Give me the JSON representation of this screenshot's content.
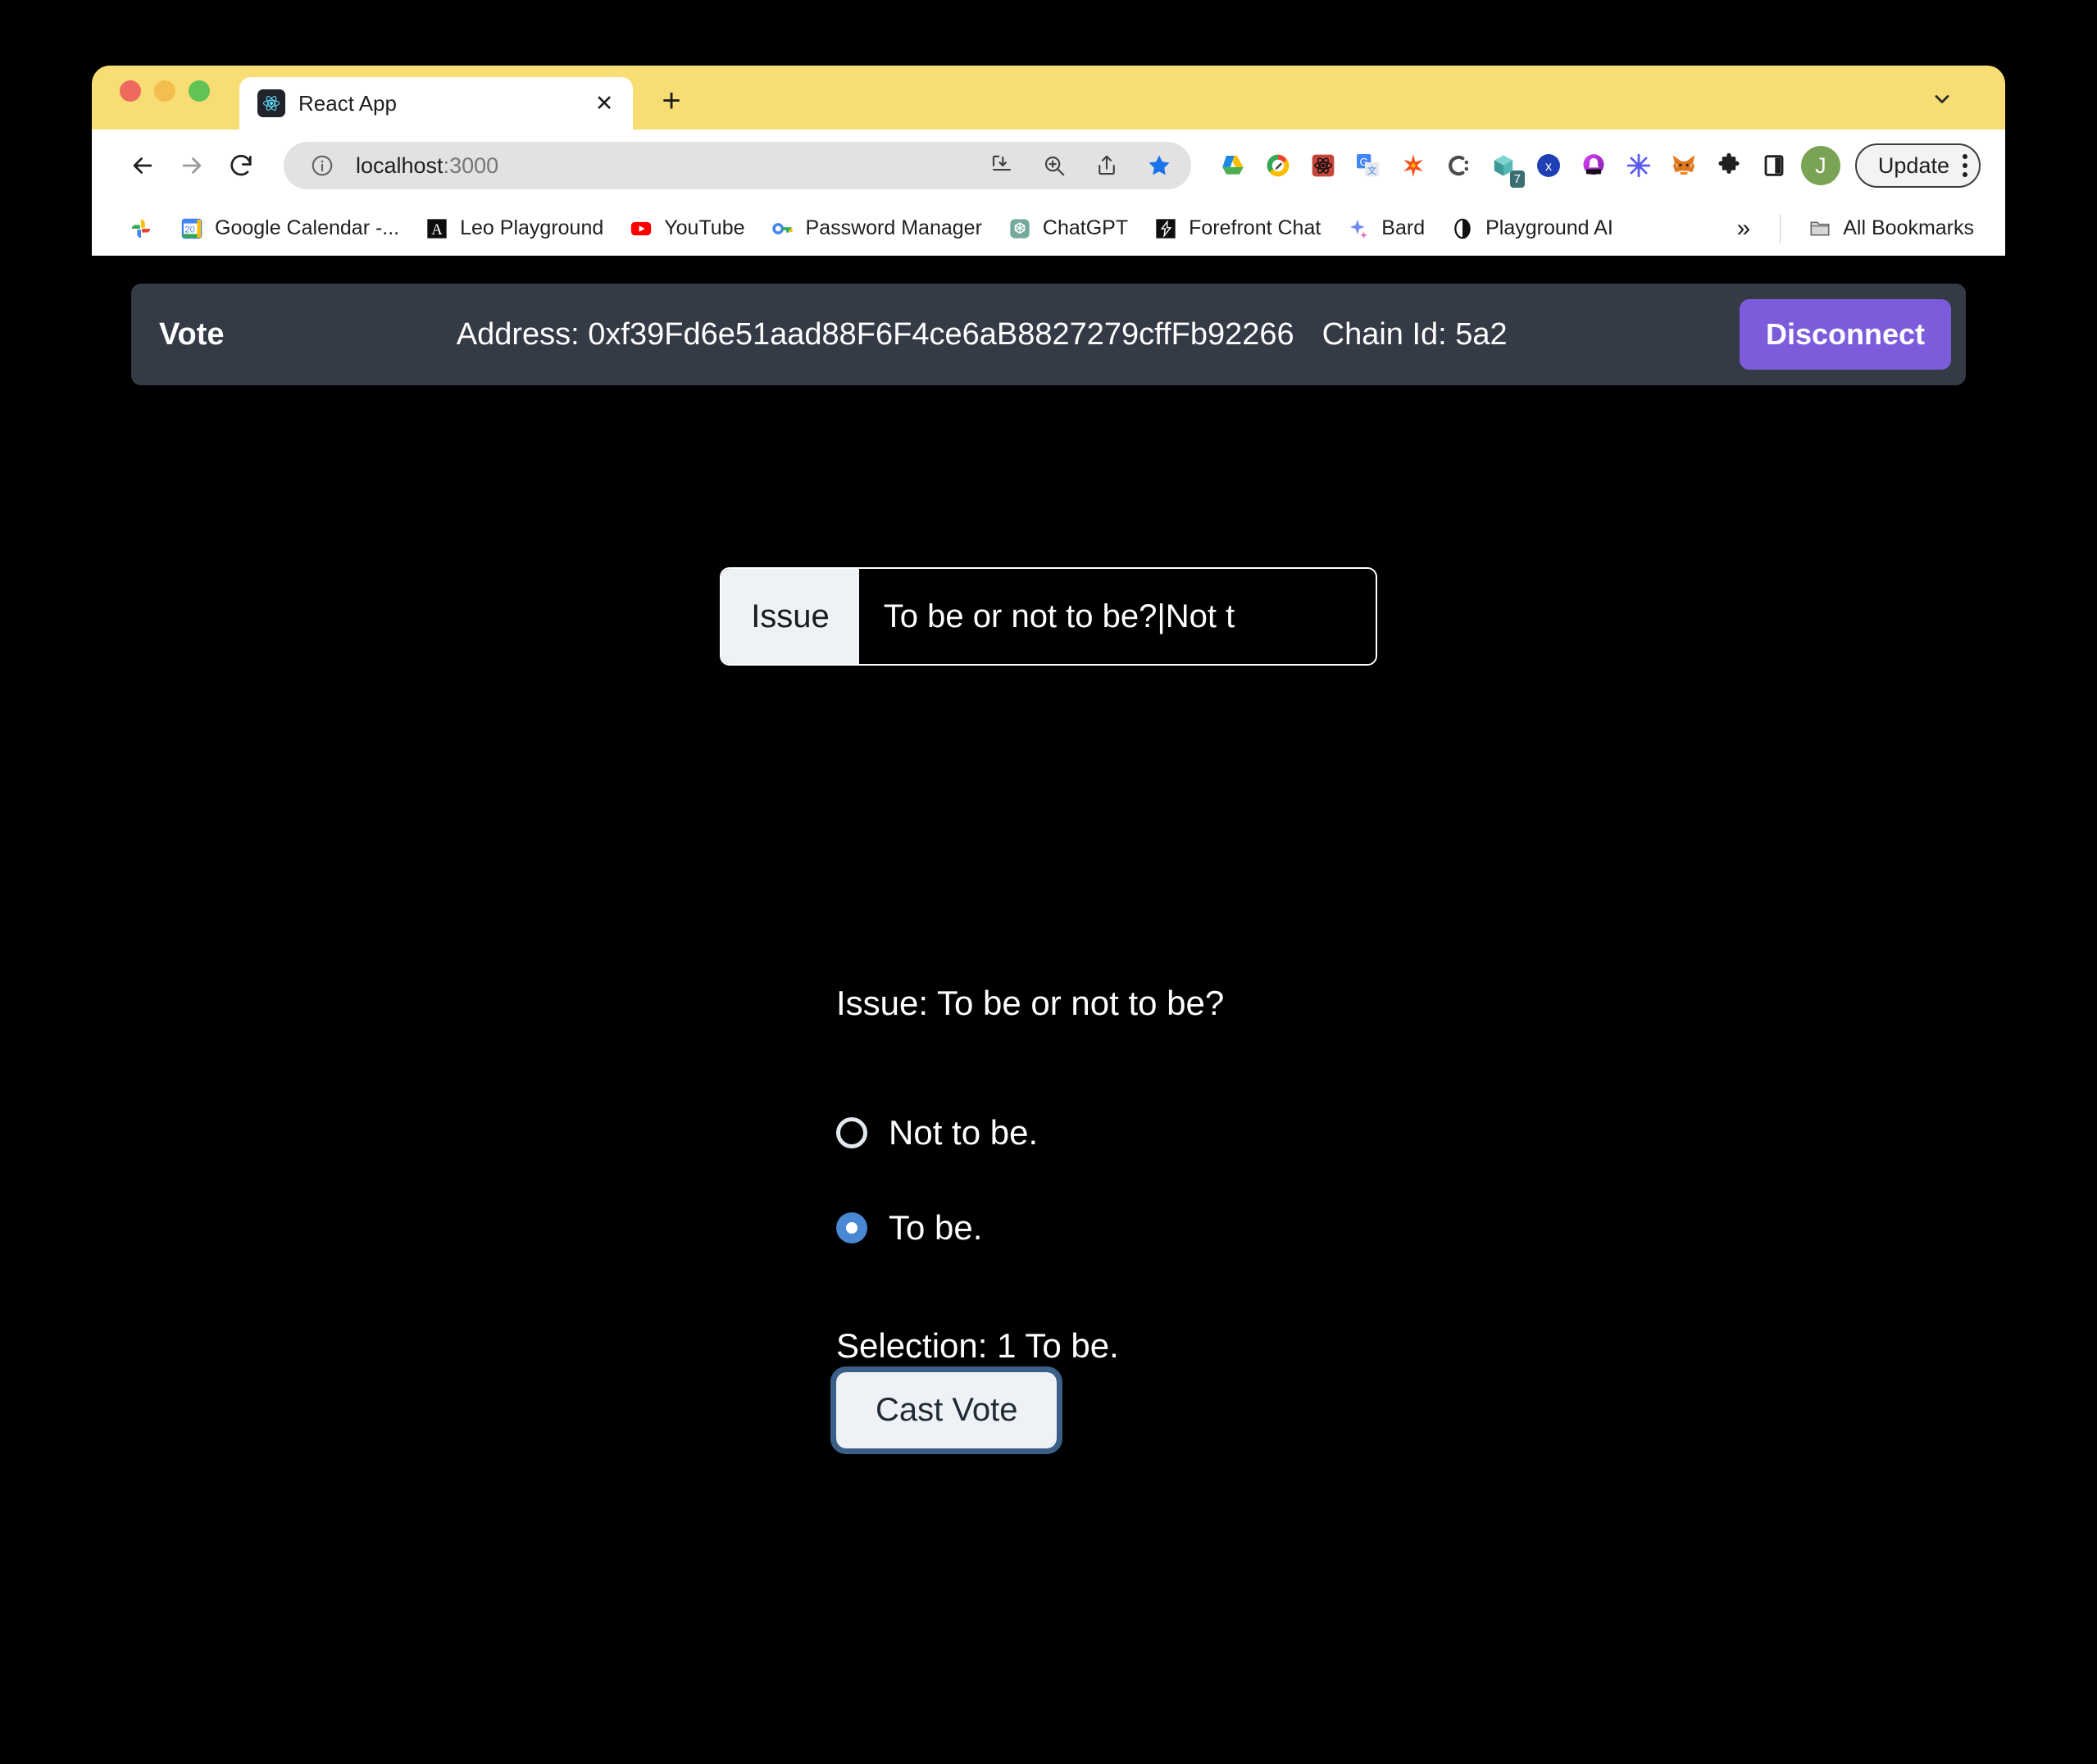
{
  "browser": {
    "tab": {
      "title": "React App",
      "favicon_icon": "react-logo-icon",
      "close_icon": "close-icon"
    },
    "new_tab_icon": "plus-icon",
    "tabstrip_chevron_icon": "chevron-down-icon",
    "traffic_lights": [
      "close-red",
      "minimize-yellow",
      "maximize-green"
    ],
    "toolbar": {
      "back_icon": "back-arrow-icon",
      "forward_icon": "forward-arrow-icon",
      "reload_icon": "reload-icon",
      "site_info_icon": "info-circle-icon",
      "url_host": "localhost",
      "url_port": ":3000",
      "omnibox_icons": [
        "install-download-icon",
        "zoom-search-icon",
        "share-icon",
        "bookmark-star-icon"
      ],
      "extensions": [
        {
          "name": "google-drive-icon",
          "glyph": "△"
        },
        {
          "name": "google-docs-pen-icon",
          "glyph": "✎"
        },
        {
          "name": "react-devtools-icon",
          "glyph": "⚛"
        },
        {
          "name": "google-translate-icon",
          "glyph": "G"
        },
        {
          "name": "sparkle-star-icon",
          "glyph": "✹"
        },
        {
          "name": "c-colon-icon",
          "glyph": "C"
        },
        {
          "name": "cube-box-icon",
          "glyph": "⬟",
          "badge": "7"
        },
        {
          "name": "x-blue-circle-icon",
          "glyph": "X"
        },
        {
          "name": "notification-bell-icon",
          "glyph": "ὑ4"
        },
        {
          "name": "asterisk-burst-icon",
          "glyph": "✳"
        },
        {
          "name": "metamask-fox-icon",
          "glyph": "ᾘA"
        },
        {
          "name": "extensions-puzzle-icon",
          "glyph": "ᾞ9"
        },
        {
          "name": "side-panel-icon",
          "glyph": "▯"
        }
      ],
      "avatar_initial": "J",
      "update_label": "Update",
      "menu_icon": "kebab-menu-icon"
    },
    "bookmarks": {
      "items": [
        {
          "label": "",
          "icon": "google-photos-icon",
          "glyph": "✿"
        },
        {
          "label": "Google Calendar -...",
          "icon": "google-calendar-icon",
          "glyph": "20"
        },
        {
          "label": "Leo Playground",
          "icon": "leo-playground-icon",
          "glyph": "A"
        },
        {
          "label": "YouTube",
          "icon": "youtube-icon",
          "glyph": "▶"
        },
        {
          "label": "Password Manager",
          "icon": "password-key-icon",
          "glyph": "⚷"
        },
        {
          "label": "ChatGPT",
          "icon": "chatgpt-icon",
          "glyph": "✻"
        },
        {
          "label": "Forefront Chat",
          "icon": "forefront-chat-icon",
          "glyph": "⬡"
        },
        {
          "label": "Bard",
          "icon": "bard-sparkle-icon",
          "glyph": "✦"
        },
        {
          "label": "Playground AI",
          "icon": "playground-ai-icon",
          "glyph": "◑"
        }
      ],
      "overflow_label": "»",
      "all_bookmarks_label": "All Bookmarks",
      "all_bookmarks_icon": "folder-icon"
    }
  },
  "app": {
    "navbar": {
      "brand": "Vote",
      "address_label": "Address: 0xf39Fd6e51aad88F6F4ce6aB8827279cffFb92266",
      "chain_label": "Chain Id: 5a2",
      "disconnect_label": "Disconnect",
      "accent_color": "#7c5cdb",
      "background_color": "#343a46"
    },
    "issue_input": {
      "prefix_label": "Issue",
      "value": "To be or not to be?|Not t",
      "placeholder": "Issue"
    },
    "issue_heading": "Issue: To be or not to be?",
    "options": [
      {
        "label": "Not to be.",
        "checked": false,
        "value": "0"
      },
      {
        "label": "To be.",
        "checked": true,
        "value": "1"
      }
    ],
    "selection_label": "Selection: 1 To be.",
    "cast_vote_label": "Cast Vote",
    "selected_radio_color": "#4a88d4",
    "focus_ring_color": "#3b6087"
  }
}
